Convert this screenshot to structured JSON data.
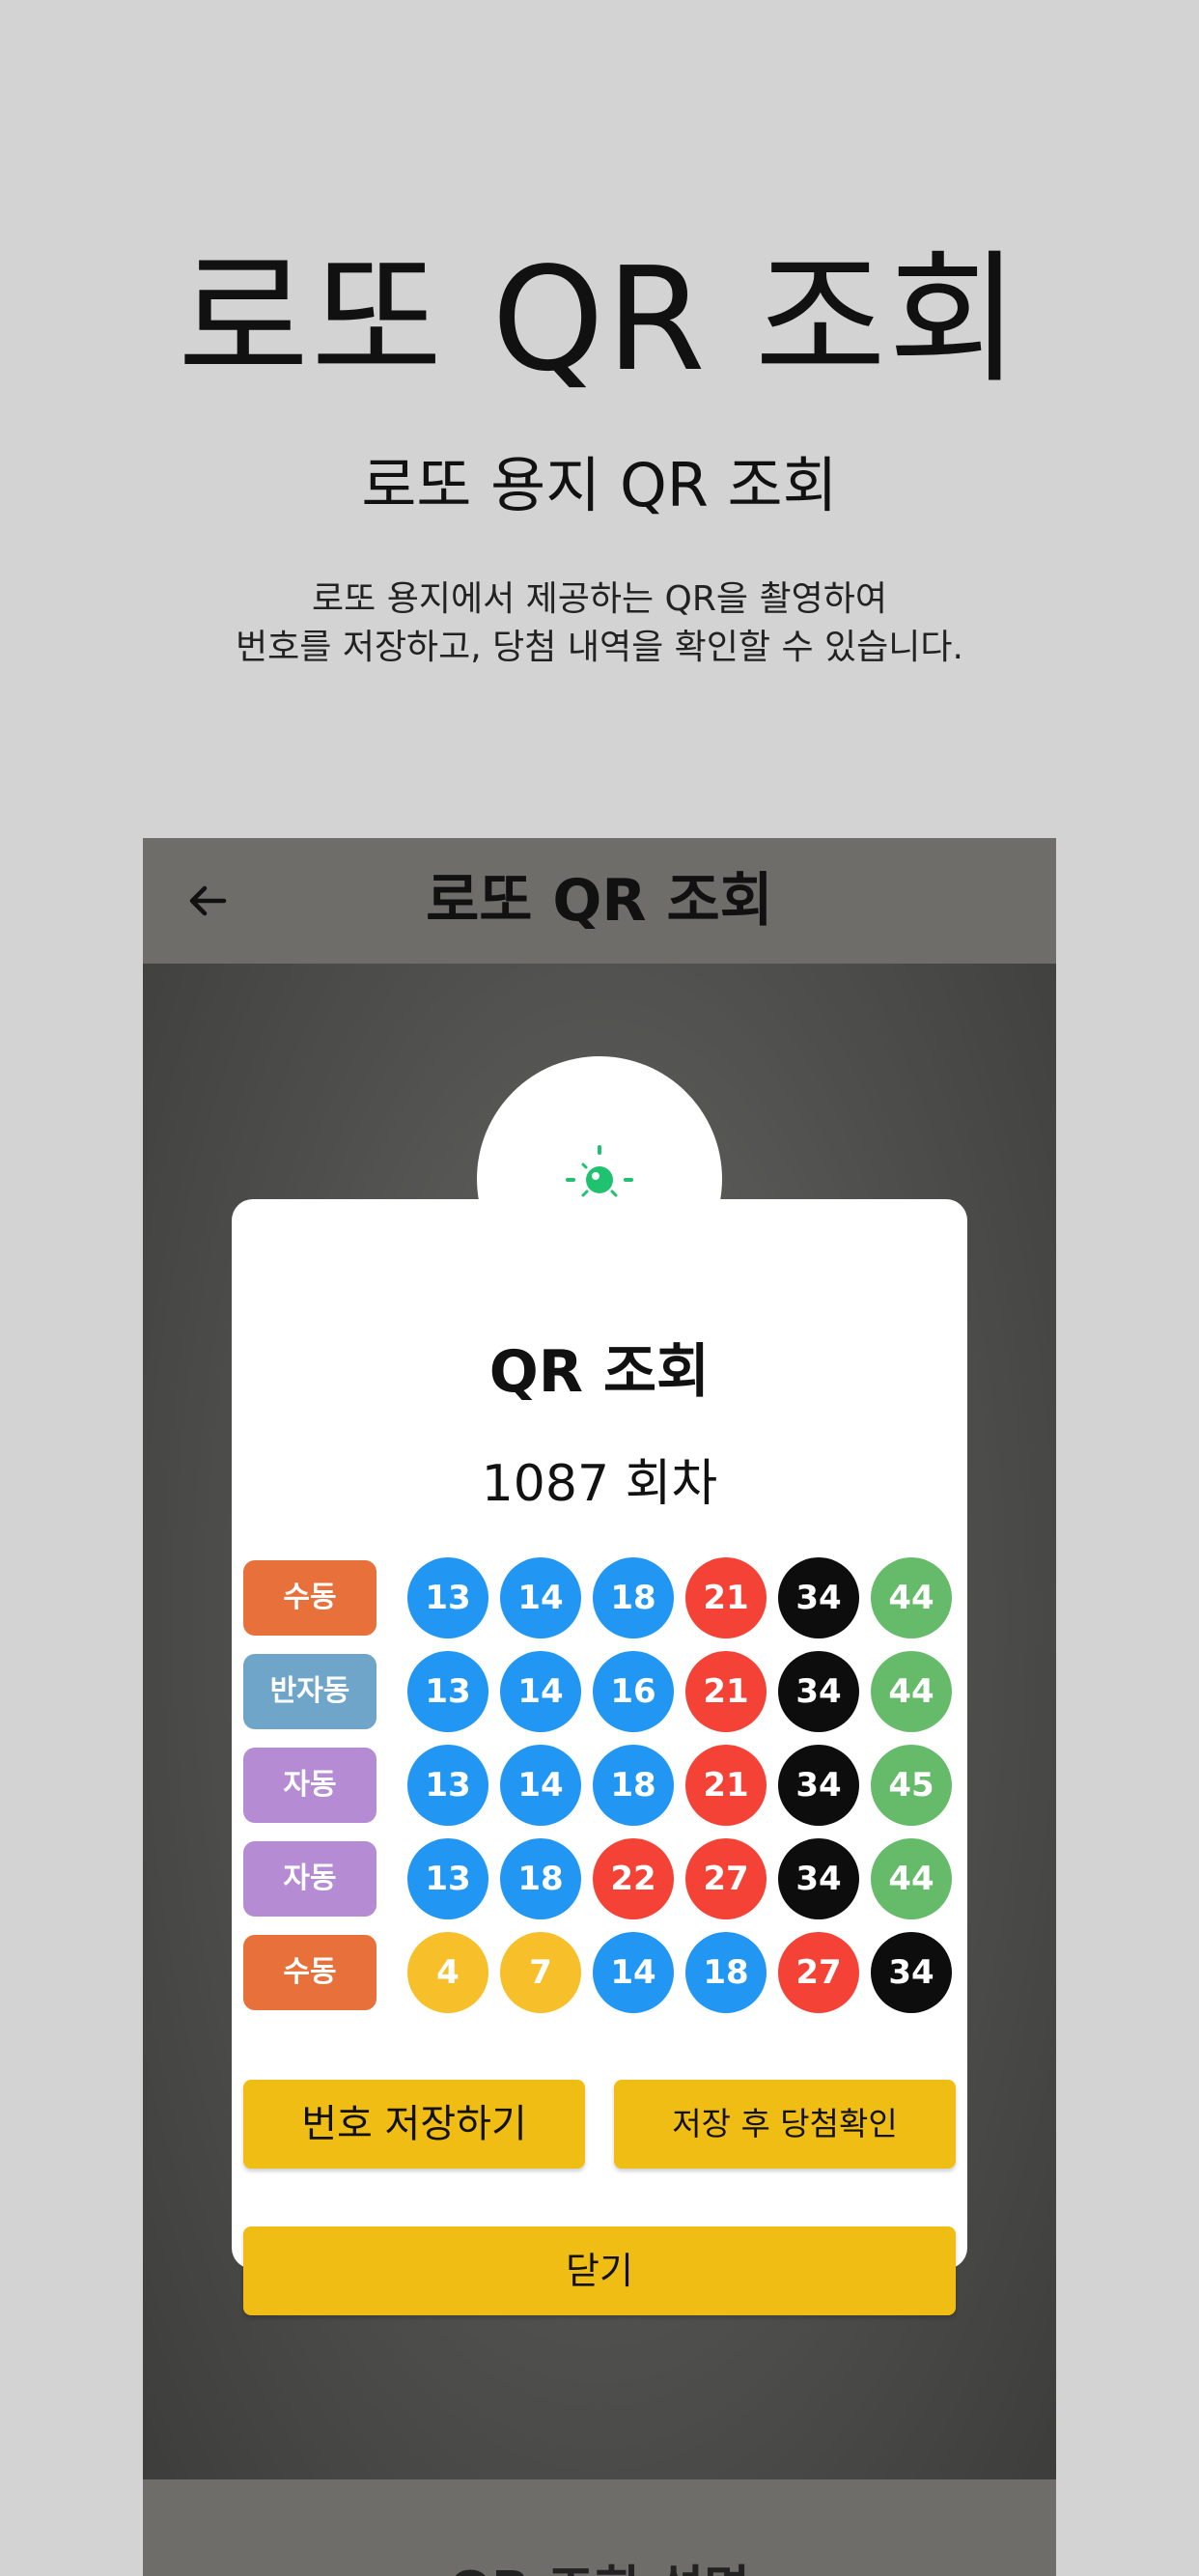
{
  "promo": {
    "title": "로또 QR 조회",
    "subtitle": "로또 용지 QR  조회",
    "description_line1": "로또 용지에서 제공하는  QR을 촬영하여",
    "description_line2": "번호를 저장하고, 당첨 내역을 확인할 수 있습니다."
  },
  "appbar": {
    "title": "로또 QR 조회",
    "back_icon": "arrow-left-icon"
  },
  "dialog": {
    "badge_icon": "qr-scan-light-icon",
    "title": "QR 조회",
    "round": "1087 회차",
    "rows": [
      {
        "mode": "수동",
        "mode_color": "#e8703a",
        "numbers": [
          "13",
          "14",
          "18",
          "21",
          "34",
          "44"
        ]
      },
      {
        "mode": "반자동",
        "mode_color": "#6ea5c8",
        "numbers": [
          "13",
          "14",
          "16",
          "21",
          "34",
          "44"
        ]
      },
      {
        "mode": "자동",
        "mode_color": "#b58bd3",
        "numbers": [
          "13",
          "14",
          "18",
          "21",
          "34",
          "45"
        ]
      },
      {
        "mode": "자동",
        "mode_color": "#b58bd3",
        "numbers": [
          "13",
          "18",
          "22",
          "27",
          "34",
          "44"
        ]
      },
      {
        "mode": "수동",
        "mode_color": "#e8703a",
        "numbers": [
          "4",
          "7",
          "14",
          "18",
          "27",
          "34"
        ]
      }
    ],
    "save_button": "번호 저장하기",
    "save_check_button": "저장 후 당첨확인",
    "close_button": "닫기"
  },
  "bottom_bar": {
    "label": "QR 조회 설명"
  },
  "colors": {
    "ball_1_10": "#f7c02a",
    "ball_11_20": "#2196f3",
    "ball_21_30": "#f44336",
    "ball_31_40": "#0d0d0d",
    "ball_41_45": "#66bb6a",
    "button": "#f0bd14",
    "accent_green": "#1fc26f"
  }
}
